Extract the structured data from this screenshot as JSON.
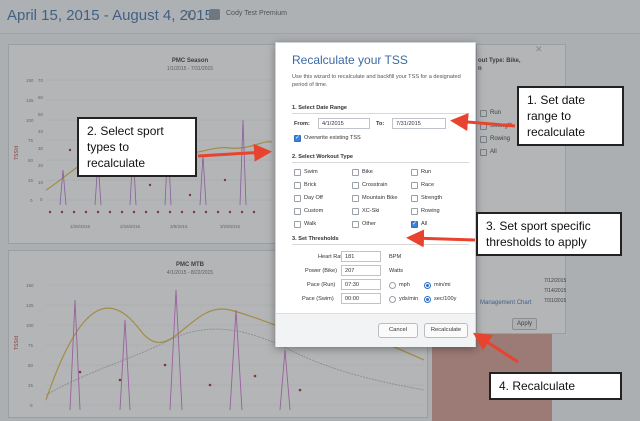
{
  "header": {
    "date_range": "April 15, 2015 - August 4, 2015",
    "refresh_icon": "refresh-icon",
    "account_name": "Cody Test Premium"
  },
  "charts": [
    {
      "title": "PMC Season",
      "subtitle": "1/1/2015 - 7/31/2015",
      "ylabel": "TSS/d",
      "yticks": [
        "150",
        "125",
        "100",
        "75",
        "50",
        "25",
        "0"
      ],
      "yticks_right": [
        "70",
        "60",
        "50",
        "40",
        "30",
        "20",
        "10",
        "0"
      ],
      "xticks": [
        "1/25/2015",
        "2/15/2015",
        "3/8/2015",
        "3/29/2015"
      ]
    },
    {
      "title": "PMC MTB",
      "subtitle": "4/1/2015 - 8/22/2015",
      "ylabel": "TSS/d",
      "yticks": [
        "150",
        "125",
        "100",
        "75",
        "50",
        "25",
        "0"
      ]
    }
  ],
  "sidebar": {
    "workout_type_label": "out Type: Bike,",
    "workout_type_label2": "n",
    "checkbox_labels": [
      "Run",
      "Strength",
      "Rowing",
      "All"
    ],
    "link": "Management Chart",
    "dates": [
      "7/12/2015",
      "7/14/2015",
      "7/31/2015"
    ],
    "apply_label": "Apply"
  },
  "modal": {
    "close_icon": "close-icon",
    "title": "Recalculate your TSS",
    "description": "Use this wizard to recalculate and backfill your TSS for a designated period of time.",
    "section1": "1. Select Date Range",
    "from_label": "From:",
    "from_value": "4/1/2015",
    "to_label": "To:",
    "to_value": "7/31/2015",
    "overwrite_label": "Overwrite existing TSS",
    "overwrite_checked": true,
    "section2": "2. Select Workout Type",
    "workout_types": [
      {
        "label": "Swim",
        "checked": false
      },
      {
        "label": "Bike",
        "checked": false
      },
      {
        "label": "Run",
        "checked": false
      },
      {
        "label": "Brick",
        "checked": false
      },
      {
        "label": "Crosstrain",
        "checked": false
      },
      {
        "label": "Race",
        "checked": false
      },
      {
        "label": "Day Off",
        "checked": false
      },
      {
        "label": "Mountain Bike",
        "checked": false
      },
      {
        "label": "Strength",
        "checked": false
      },
      {
        "label": "Custom",
        "checked": false
      },
      {
        "label": "XC-Ski",
        "checked": false
      },
      {
        "label": "Rowing",
        "checked": false
      },
      {
        "label": "Walk",
        "checked": false
      },
      {
        "label": "Other",
        "checked": false
      },
      {
        "label": "All",
        "checked": true
      }
    ],
    "section3": "3. Set Thresholds",
    "thresholds": [
      {
        "label": "Heart Rate",
        "value": "181",
        "unit": "BPM"
      },
      {
        "label": "Power (Bike)",
        "value": "207",
        "unit": "Watts"
      },
      {
        "label": "Pace (Run)",
        "value": "07:30",
        "unit_a": "mph",
        "unit_b": "min/mi",
        "selected": "b"
      },
      {
        "label": "Pace (Swim)",
        "value": "00:00",
        "unit_a": "yds/min",
        "unit_b": "sec/100y",
        "selected": "b"
      }
    ],
    "cancel_label": "Cancel",
    "recalculate_label": "Recalculate"
  },
  "annotations": {
    "callout1": "1. Set date range to recalculate",
    "callout2": "2. Select sport types to recalculate",
    "callout3": "3. Set sport specific thresholds to apply",
    "callout4": "4. Recalculate",
    "arrow_color": "#e8432e"
  }
}
